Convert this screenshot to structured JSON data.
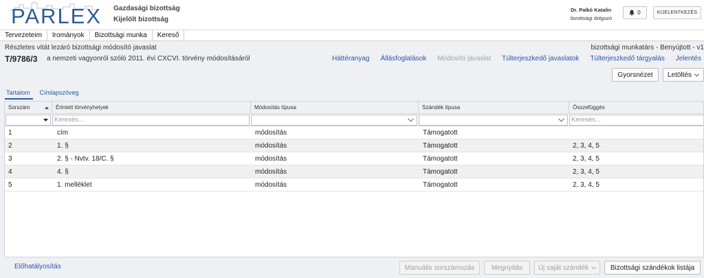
{
  "header": {
    "logo_text": "PARLEX",
    "committee_line1": "Gazdasági bizottság",
    "committee_line2": "Kijelölt bizottság",
    "user_name": "Dr. Palkó Katalin",
    "user_role": "bizottsági dolgozó",
    "notification_count": "0",
    "logout_label": "KIJELENTKEZÉS"
  },
  "menu": [
    "Tervezeteim",
    "Irományok",
    "Bizottsági munka",
    "Kereső"
  ],
  "document": {
    "subtitle": "Részletes vitát lezáró bizottsági módosító javaslat",
    "status": "bizottsági munkatárs - Benyújtott - v1",
    "id": "T/9786/3",
    "title": "a nemzeti vagyonról szóló 2011. évi CXCVI. törvény módosításáról",
    "links": [
      {
        "label": "Háttéranyag",
        "disabled": false
      },
      {
        "label": "Állásfoglalások",
        "disabled": false
      },
      {
        "label": "Módosító javaslat",
        "disabled": true
      },
      {
        "label": "Túlterjeszkedő javaslatok",
        "disabled": false
      },
      {
        "label": "Túlterjeszkedő tárgyalás",
        "disabled": false
      },
      {
        "label": "Jelentés",
        "disabled": false
      }
    ],
    "preview_button": "Gyorsnézet",
    "download_button": "Letöltés"
  },
  "tabs": [
    {
      "label": "Tartalom",
      "active": true
    },
    {
      "label": "Címlapszöveg",
      "active": false
    }
  ],
  "grid": {
    "columns": [
      "Sorszám",
      "Érintett törvényhelyek",
      "Módosítás típusa",
      "Szándék típusa",
      "Összefüggés"
    ],
    "search_placeholder": "Keresés...",
    "rows": [
      [
        "1",
        "cím",
        "módosítás",
        "Támogatott",
        ""
      ],
      [
        "2",
        "1. §",
        "módosítás",
        "Támogatott",
        "2, 3, 4, 5"
      ],
      [
        "3",
        "2. § - Nvtv. 18/C. §",
        "módosítás",
        "Támogatott",
        "2, 3, 4, 5"
      ],
      [
        "4",
        "4. §",
        "módosítás",
        "Támogatott",
        "2, 3, 4, 5"
      ],
      [
        "5",
        "1. melléklet",
        "módosítás",
        "Támogatott",
        "2, 3, 4, 5"
      ]
    ]
  },
  "footer": {
    "precedence_link": "Előhatályosítás",
    "manual_numbering": "Manuális sorszámozás",
    "open": "Megnyitás",
    "new_intent": "Új saját szándék",
    "committee_intents": "Bizottsági szándékok listája"
  },
  "colors": {
    "brand": "#2e5b9a",
    "link": "#2a56a8",
    "panel_bg": "#eef0f3"
  }
}
